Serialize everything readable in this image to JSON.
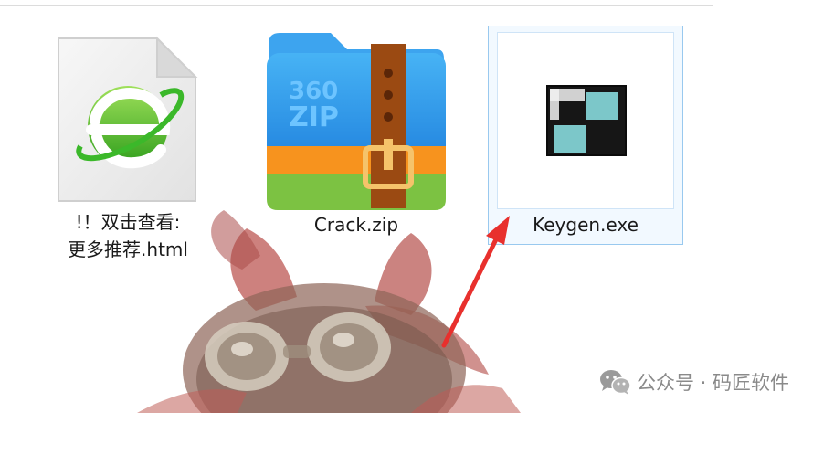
{
  "files": [
    {
      "name_line1": "!！双击查看:",
      "name_line2": "更多推荐.html",
      "icon": "html-document-icon",
      "selected": false
    },
    {
      "name": "Crack.zip",
      "icon": "zip-archive-icon",
      "icon_text_top": "360",
      "icon_text_bottom": "ZIP",
      "selected": false
    },
    {
      "name": "Keygen.exe",
      "icon": "exe-application-icon",
      "selected": true
    }
  ],
  "watermark": {
    "text": "公众号 · 码匠软件",
    "icon": "wechat-icon"
  },
  "colors": {
    "selection_border": "#99c9ef",
    "arrow": "#e8302d",
    "zip_blue": "#2f8fe6",
    "zip_orange": "#f7931e",
    "zip_green": "#7cc242",
    "zip_strap": "#9b4a12",
    "exe_teal": "#7cc7c9"
  }
}
